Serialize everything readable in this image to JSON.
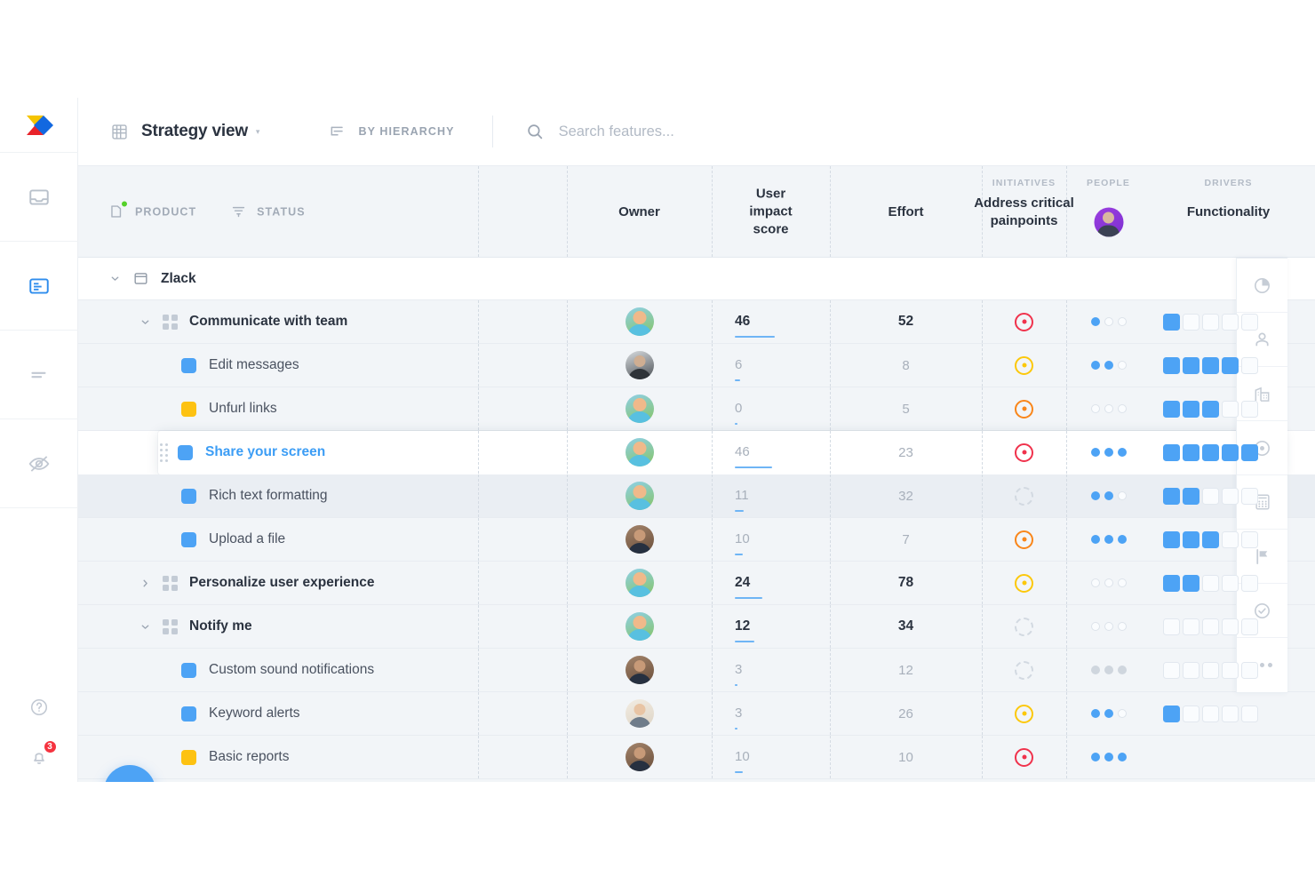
{
  "app": {
    "logo_name": "productboard-logo"
  },
  "left_rail": {
    "items": [
      {
        "name": "inbox-icon",
        "label": "Inbox"
      },
      {
        "name": "features-board-icon",
        "label": "Features",
        "active": true
      },
      {
        "name": "roadmap-icon",
        "label": "Roadmaps"
      },
      {
        "name": "insights-icon",
        "label": "Insights"
      }
    ],
    "bottom": [
      {
        "name": "help-icon",
        "label": "Help"
      },
      {
        "name": "notifications-bell-icon",
        "label": "Notifications",
        "badge": "3"
      }
    ]
  },
  "topbar": {
    "view_icon": "grid-view-icon",
    "view_title": "Strategy view",
    "view_caret": "▾",
    "hierarchy_icon": "hierarchy-icon",
    "hierarchy_label": "BY HIERARCHY",
    "search_icon": "search-icon",
    "search_value": "",
    "search_placeholder": "Search features..."
  },
  "table": {
    "facets": [
      {
        "icon": "product-icon",
        "label": "PRODUCT",
        "dot_color": "#55d12a"
      },
      {
        "icon": "status-filter-icon",
        "label": "STATUS"
      }
    ],
    "columns": [
      {
        "key": "owner",
        "eyebrow": "",
        "title": "Owner"
      },
      {
        "key": "impact",
        "eyebrow": "",
        "title": "User impact score"
      },
      {
        "key": "effort",
        "eyebrow": "",
        "title": "Effort"
      },
      {
        "key": "initiatives",
        "eyebrow": "INITIATIVES",
        "title": "Address critical painpoints"
      },
      {
        "key": "people",
        "eyebrow": "PEOPLE",
        "title": ""
      },
      {
        "key": "drivers",
        "eyebrow": "DRIVERS",
        "title": "Functionality"
      }
    ],
    "rows": [
      {
        "type": "project",
        "indent": 0,
        "toggle": "expanded",
        "icon": "project-icon",
        "label": "Zlack"
      },
      {
        "type": "group",
        "indent": 1,
        "toggle": "expanded",
        "icon": "component-icon",
        "label": "Communicate with team",
        "owner": "avatar-blond-man",
        "impact": "46",
        "impact_bar": 62,
        "effort": "52",
        "bold": true,
        "initiative": "red",
        "people": [
          1,
          0,
          0
        ],
        "drivers": 1
      },
      {
        "type": "feature",
        "indent": 2,
        "swatch": "#4da3f5",
        "label": "Edit messages",
        "owner": "avatar-grey-man",
        "impact": "6",
        "impact_bar": 9,
        "effort": "8",
        "bold": false,
        "initiative": "yellow",
        "people": [
          1,
          1,
          0
        ],
        "drivers": 4
      },
      {
        "type": "feature",
        "indent": 2,
        "swatch": "#fdc212",
        "label": "Unfurl links",
        "owner": "avatar-blond-man",
        "impact": "0",
        "impact_bar": 2,
        "effort": "5",
        "bold": false,
        "initiative": "orange",
        "people": [
          0,
          0,
          0
        ],
        "drivers": 3
      },
      {
        "type": "feature",
        "indent": 2,
        "swatch": "#4da3f5",
        "label": "Share your screen",
        "owner": "avatar-blond-man",
        "impact": "46",
        "impact_bar": 58,
        "effort": "23",
        "bold": false,
        "initiative": "red",
        "people": [
          1,
          1,
          1
        ],
        "drivers": 5,
        "highlight": true,
        "selected": true,
        "draggable": true
      },
      {
        "type": "feature",
        "indent": 2,
        "swatch": "#4da3f5",
        "label": "Rich text formatting",
        "owner": "avatar-blond-man",
        "impact": "11",
        "impact_bar": 14,
        "effort": "32",
        "bold": false,
        "initiative": "none",
        "people": [
          1,
          1,
          0
        ],
        "drivers": 2,
        "shaded": true
      },
      {
        "type": "feature",
        "indent": 2,
        "swatch": "#4da3f5",
        "label": "Upload a file",
        "owner": "avatar-dark-man",
        "impact": "10",
        "impact_bar": 13,
        "effort": "7",
        "bold": false,
        "initiative": "orange",
        "people": [
          1,
          1,
          1
        ],
        "drivers": 3
      },
      {
        "type": "group",
        "indent": 1,
        "toggle": "collapsed",
        "icon": "component-icon",
        "label": "Personalize user experience",
        "owner": "avatar-blond-man",
        "impact": "24",
        "impact_bar": 43,
        "effort": "78",
        "bold": true,
        "initiative": "yellow",
        "people": [
          0,
          0,
          0
        ],
        "drivers": 2
      },
      {
        "type": "group",
        "indent": 1,
        "toggle": "expanded",
        "icon": "component-icon",
        "label": "Notify me",
        "owner": "avatar-blond-man",
        "impact": "12",
        "impact_bar": 31,
        "effort": "34",
        "bold": true,
        "initiative": "none",
        "people": [
          0,
          0,
          0
        ],
        "drivers": 0
      },
      {
        "type": "feature",
        "indent": 2,
        "swatch": "#4da3f5",
        "label": "Custom sound notifications",
        "owner": "avatar-dark-man",
        "impact": "3",
        "impact_bar": 4,
        "effort": "12",
        "bold": false,
        "initiative": "none",
        "people": [
          2,
          2,
          2
        ],
        "drivers": 0
      },
      {
        "type": "feature",
        "indent": 2,
        "swatch": "#4da3f5",
        "label": "Keyword alerts",
        "owner": "avatar-pale-man",
        "impact": "3",
        "impact_bar": 4,
        "effort": "26",
        "bold": false,
        "initiative": "yellow",
        "people": [
          1,
          1,
          0
        ],
        "drivers": 1
      },
      {
        "type": "feature",
        "indent": 2,
        "swatch": "#fdc212",
        "label": "Basic reports",
        "owner": "avatar-dark-man",
        "impact": "10",
        "impact_bar": 13,
        "effort": "10",
        "bold": false,
        "initiative": "red",
        "people": [
          1,
          1,
          1
        ],
        "drivers": -1
      }
    ]
  },
  "right_rail": {
    "items": [
      {
        "name": "pie-chart-icon",
        "label": "Insights"
      },
      {
        "name": "person-icon",
        "label": "People"
      },
      {
        "name": "company-icon",
        "label": "Companies"
      },
      {
        "name": "objective-icon",
        "label": "Objectives"
      },
      {
        "name": "calculator-icon",
        "label": "Scores"
      },
      {
        "name": "flag-icon",
        "label": "Releases"
      },
      {
        "name": "check-circle-icon",
        "label": "Status"
      },
      {
        "name": "more-icon",
        "label": "More"
      }
    ]
  },
  "fab": {
    "name": "add-feature-fab",
    "label": "+"
  },
  "colors": {
    "accent": "#4da3f5",
    "table_bg": "#f2f5f8",
    "red": "#f03a52",
    "orange": "#f98318",
    "yellow": "#fcc30b",
    "green": "#55d12a"
  }
}
